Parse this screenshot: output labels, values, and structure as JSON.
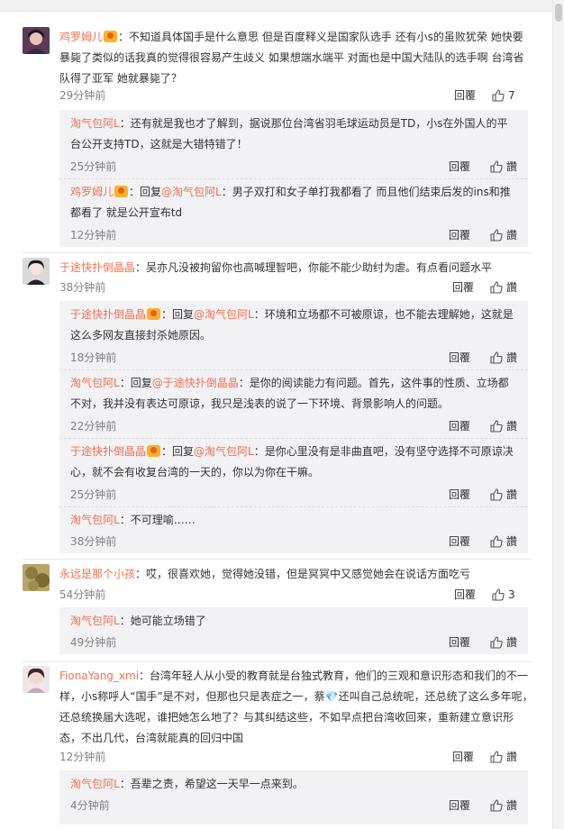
{
  "comments": [
    {
      "user": "鸡罗姆儿",
      "text": "：不知道具体国手是什么意思 但是百度释义是国家队选手 还有小s的虽败犹荣 她快要暴毙了类似的话我真的觉得很容易产生歧义 如果想端水端平 对面也是中国大陆队的选手啊 台湾省队得了亚军 她就暴毙了？",
      "time": "29分钟前",
      "reply": "回覆",
      "likes": "7",
      "replies": [
        {
          "user": "淘气包阿L",
          "text": "：还有就是我也才了解到，据说那位台湾省羽毛球运动员是TD，小s在外国人的平台公开支持TD，这就是大错特错了！",
          "time": "25分钟前",
          "reply": "回覆",
          "like": "讚"
        },
        {
          "user": "鸡罗姆儿",
          "text_pre": "：回复",
          "mention": "@淘气包阿L",
          "text": "：男子双打和女子单打我都看了 而且他们结束后发的ins和推都看了 就是公开宣布td",
          "time": "12分钟前",
          "reply": "回覆",
          "like": "讚"
        }
      ]
    },
    {
      "user": "于途快扑倒晶晶",
      "text": "：吴亦凡没被拘留你也高喊理智吧，你能不能少助纣为虐。有点看问题水平",
      "time": "38分钟前",
      "reply": "回覆",
      "likes": "讚",
      "replies": [
        {
          "user": "于途快扑倒晶晶",
          "text_pre": "：回复",
          "mention": "@淘气包阿L",
          "text": "：环境和立场都不可被原谅，也不能去理解她，这就是这么多网友直接封杀她原因。",
          "time": "18分钟前",
          "reply": "回覆",
          "like": "讚"
        },
        {
          "user": "淘气包阿L",
          "text_pre": "：回复",
          "mention": "@于途快扑倒晶晶",
          "text": "：是你的阅读能力有问题。首先，这件事的性质、立场都不对，我并没有表达可原谅，我只是浅表的说了一下环境、背景影响人的问题。",
          "time": "22分钟前",
          "reply": "回覆",
          "like": "讚"
        },
        {
          "user": "于途快扑倒晶晶",
          "text_pre": "：回复",
          "mention": "@淘气包阿L",
          "text": "：是你心里没有是非曲直吧，没有坚守选择不可原谅决心，就不会有收复台湾的一天的，你以为你在干嘛。",
          "time": "25分钟前",
          "reply": "回覆",
          "like": "讚"
        },
        {
          "user": "淘气包阿L",
          "text": "：不可理喻……",
          "time": "38分钟前",
          "reply": "回覆",
          "like": "讚"
        }
      ]
    },
    {
      "user": "永远是那个小孩",
      "text": "：哎，很喜欢她，觉得她没错，但是冥冥中又感觉她会在说话方面吃亏",
      "time": "54分钟前",
      "reply": "回覆",
      "likes": "3",
      "replies": [
        {
          "user": "淘气包阿L",
          "text": "：她可能立场错了",
          "time": "49分钟前",
          "reply": "回覆",
          "like": "讚"
        }
      ]
    },
    {
      "user": "FionaYang_xmi",
      "text": "：台湾年轻人从小受的教育就是台独式教育，他们的三观和意识形态和我们的不一样，小s称呼人“国手”是不对，但那也只是表症之一，蔡💎还叫自己总统呢，还总统了这么多年呢，还总统换届大选呢，谁把她怎么地了？与其纠结这些，不如早点把台湾收回来，重新建立意识形态，不出几代，台湾就能真的回归中国",
      "time": "12分钟前",
      "reply": "回覆",
      "likes": "讚",
      "replies": [
        {
          "user": "淘气包阿L",
          "text": "：吾辈之责，希望这一天早一点来到。",
          "time": "4分钟前",
          "reply": "回覆",
          "like": "讚"
        }
      ]
    }
  ],
  "colors": {
    "username": "#eb7350",
    "sub_bg": "#f2f2f5"
  }
}
